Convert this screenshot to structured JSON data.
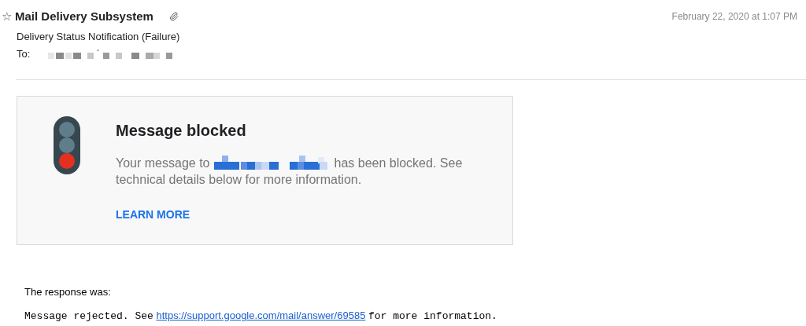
{
  "header": {
    "star": "☆",
    "sender": "Mail Delivery Subsystem",
    "has_attachment": true,
    "date": "February 22, 2020 at 1:07 PM",
    "subject": "Delivery Status Notification (Failure)",
    "to_label": "To:"
  },
  "notice": {
    "title": "Message blocked",
    "text_before": "Your message to",
    "text_after": "has been blocked. See",
    "text_line2": "technical details below for more information.",
    "link": "LEARN MORE"
  },
  "response": {
    "label": "The response was:",
    "text_before": "Message rejected. See",
    "link": "https://support.google.com/mail/answer/69585",
    "text_after": "for more information."
  }
}
